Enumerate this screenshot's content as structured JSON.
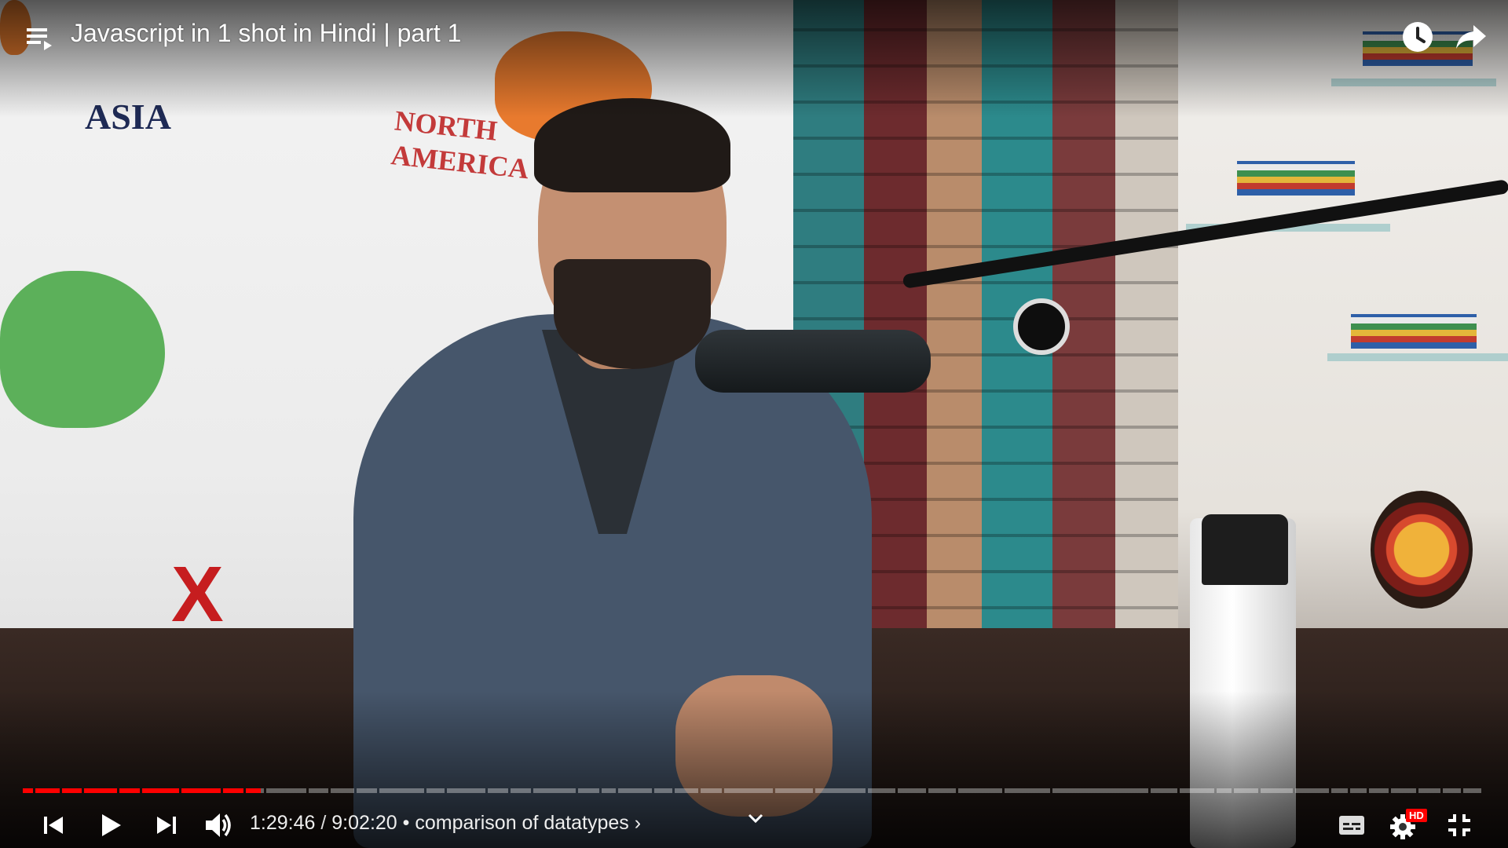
{
  "video": {
    "title": "Javascript in 1 shot in Hindi | part 1",
    "map_labels": {
      "asia": "ASIA",
      "north_america": "NORTH AMERICA"
    },
    "tedx_text": "X"
  },
  "top_actions": {
    "watch_later_icon": "clock-icon",
    "share_icon": "share-arrow-icon",
    "playlist_icon": "playlist-icon"
  },
  "player": {
    "current_time": "1:29:46",
    "duration": "9:02:20",
    "time_separator": "/",
    "chapter_bullet": "•",
    "chapter_title": "comparison of datatypes",
    "chapter_chevron": "›",
    "played_fraction": 0.163,
    "quality_badge": "HD",
    "accent_color": "#ff0000"
  },
  "controls": {
    "previous_icon": "skip-previous-icon",
    "play_icon": "play-icon",
    "next_icon": "skip-next-icon",
    "volume_icon": "volume-icon",
    "expand_icon": "chevron-down-icon",
    "subtitles_icon": "subtitles-icon",
    "settings_icon": "gear-icon",
    "exit_fullscreen_icon": "exit-fullscreen-icon"
  }
}
